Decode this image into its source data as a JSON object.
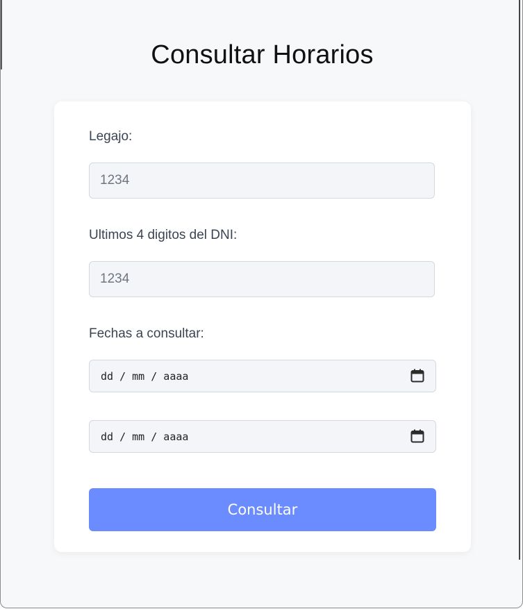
{
  "page": {
    "title": "Consultar Horarios"
  },
  "form": {
    "legajo": {
      "label": "Legajo:",
      "placeholder": "1234",
      "value": ""
    },
    "dni": {
      "label": "Ultimos 4 digitos del DNI:",
      "placeholder": "1234",
      "value": ""
    },
    "fechas": {
      "label": "Fechas a consultar:",
      "desde": {
        "placeholder": "dd / mm / aaaa",
        "icon": "calendar-icon"
      },
      "hasta": {
        "placeholder": "dd / mm / aaaa",
        "icon": "calendar-icon"
      }
    },
    "submit_label": "Consultar"
  },
  "colors": {
    "background": "#f7f8fa",
    "card": "#ffffff",
    "input_background": "#f3f5f8",
    "input_border": "#d4d9e0",
    "label_text": "#3a4553",
    "button": "#6b8cff",
    "button_text": "#ffffff"
  }
}
